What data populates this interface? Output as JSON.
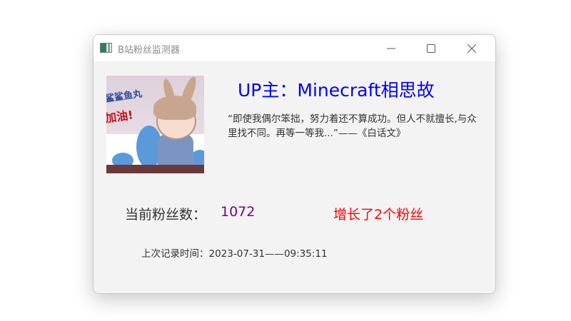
{
  "window": {
    "title": "B站粉丝监测器"
  },
  "avatar": {
    "lettering": "鲨鲨鱼丸 加油!"
  },
  "uploader": {
    "label": "UP主：Minecraft相思故"
  },
  "quote": "“即使我偶尔笨拙，努力着还不算成功。但人不就擅长,与众里找不同。再等一等我...”——《白话文》",
  "fans": {
    "label": "当前粉丝数：",
    "count": "1072",
    "growth": "增长了2个粉丝"
  },
  "last_record": "上次记录时间：2023-07-31——09:35:11",
  "colors": {
    "uploader": "#0000ff",
    "count": "#800080",
    "growth": "#ff0000"
  }
}
